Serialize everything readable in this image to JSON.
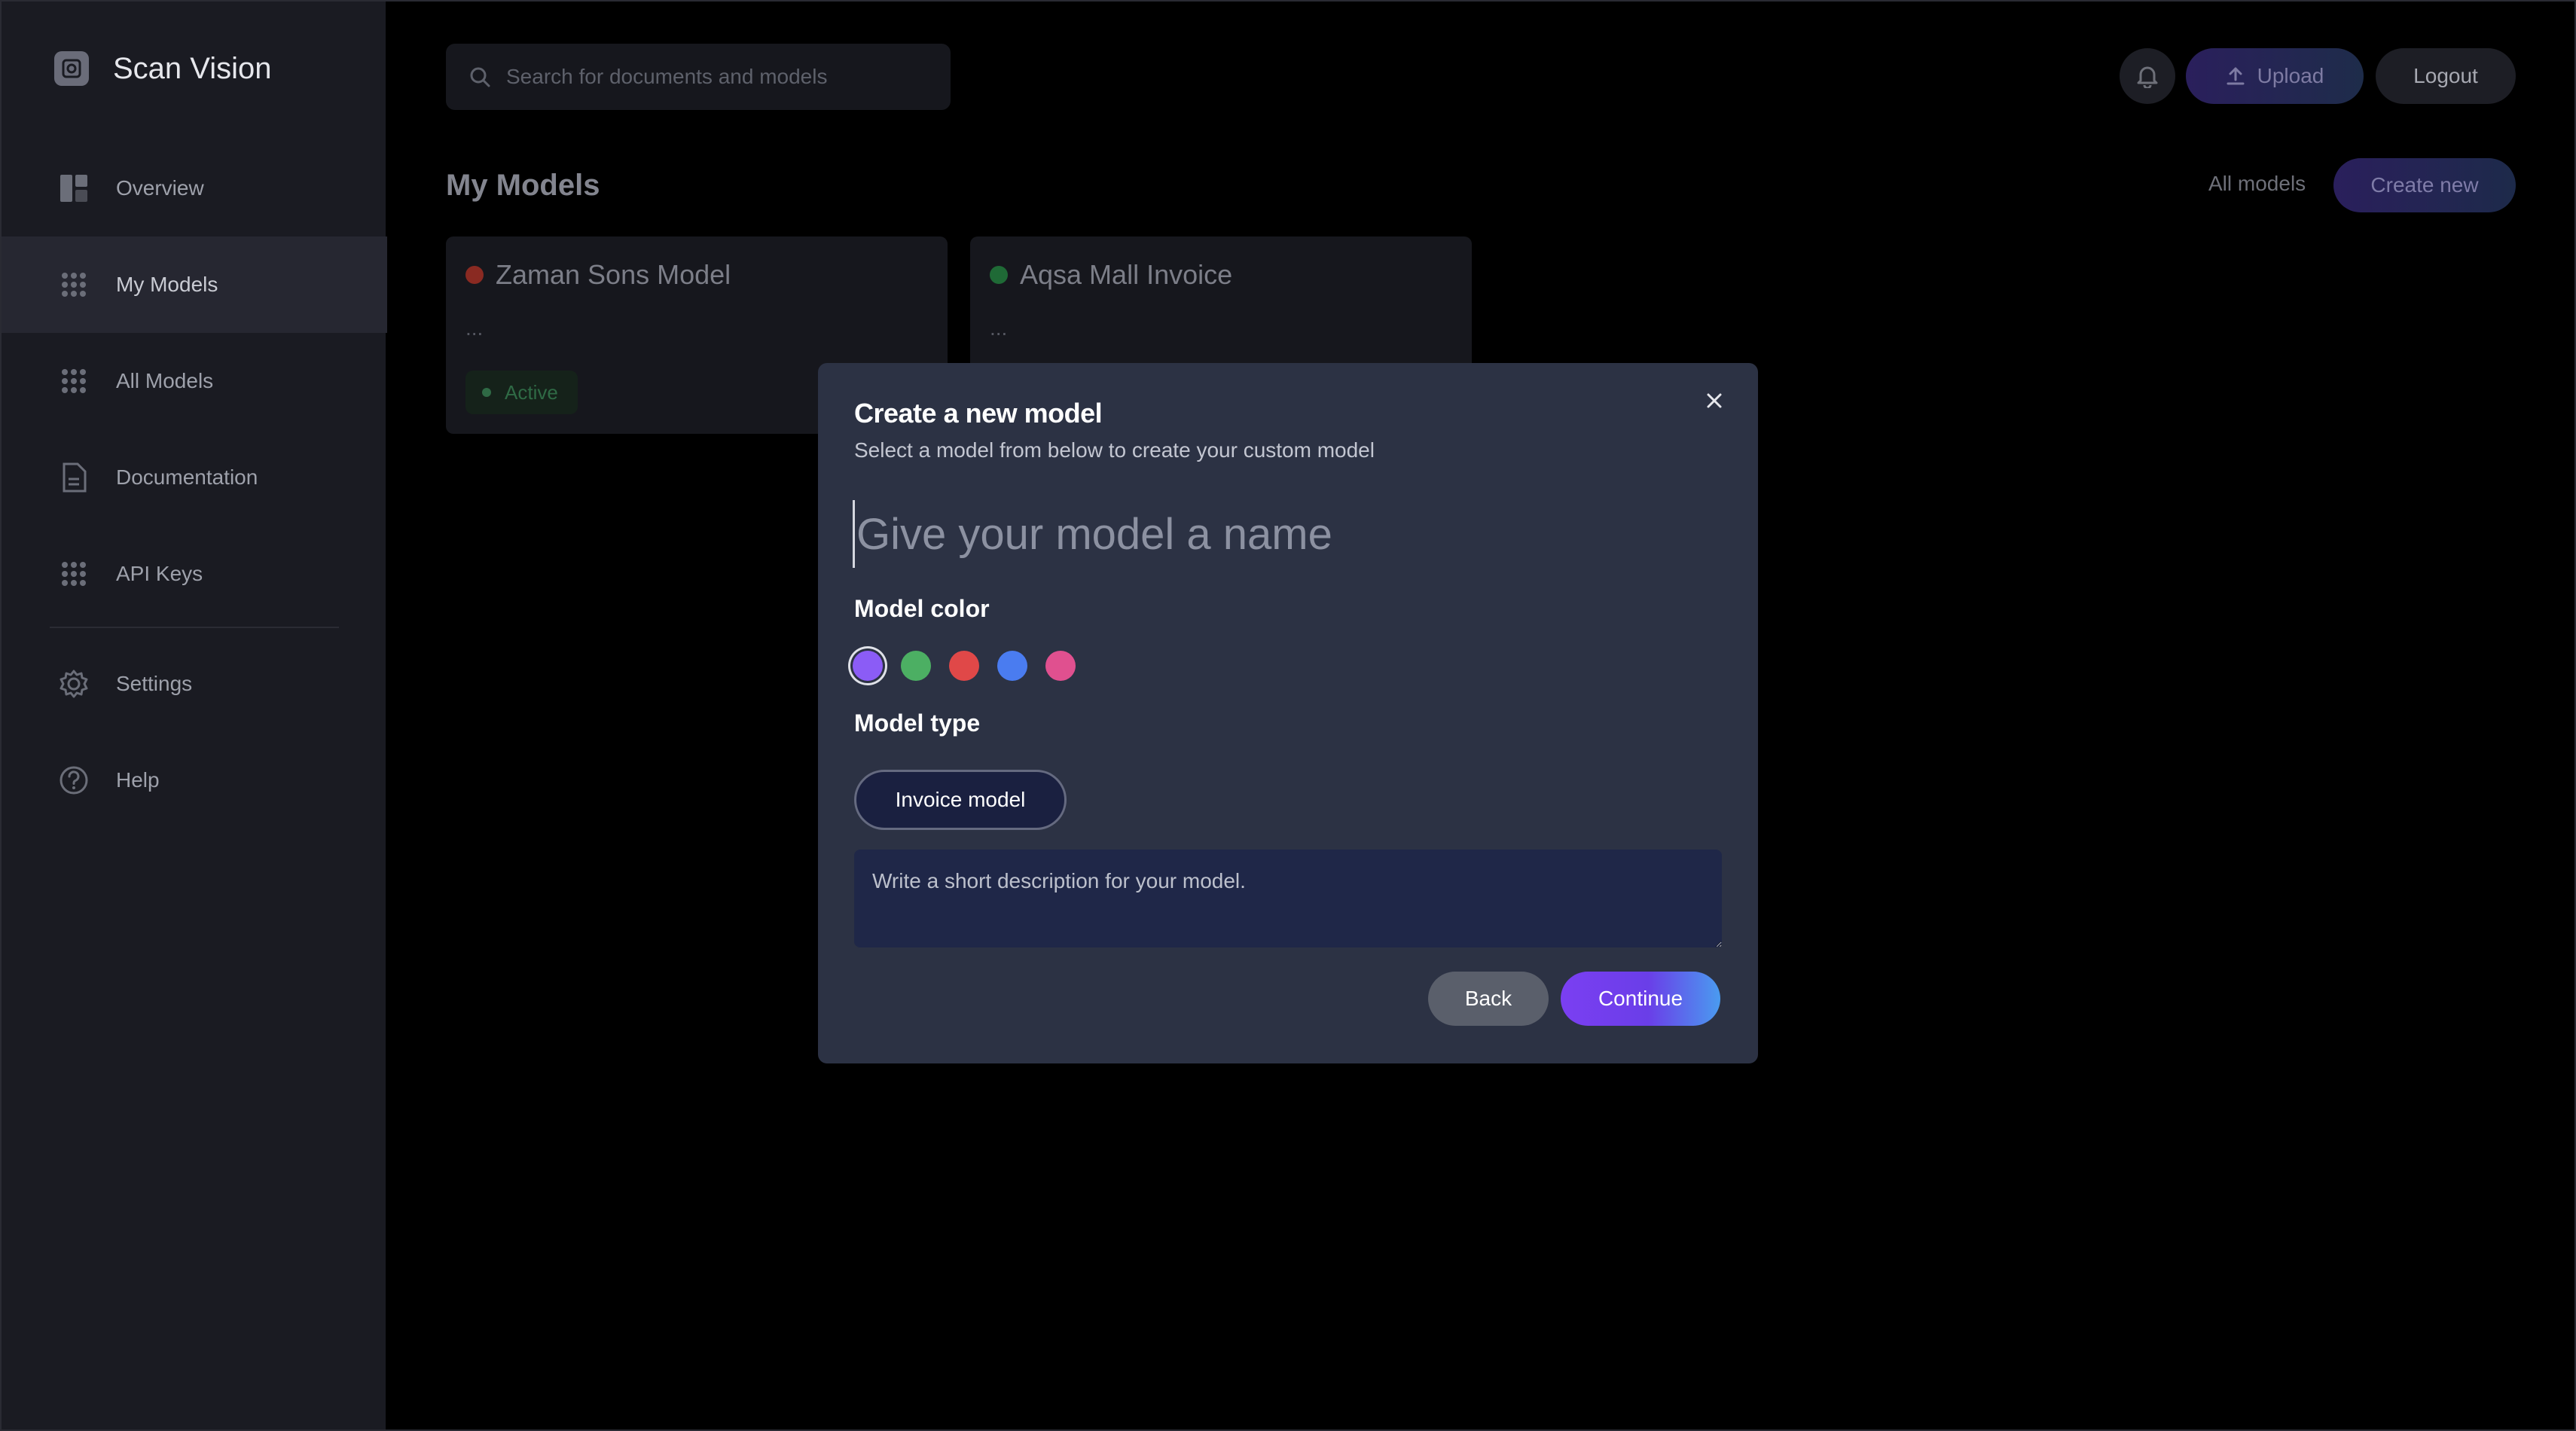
{
  "app": {
    "name": "Scan Vision"
  },
  "sidebar": {
    "items": [
      {
        "label": "Overview",
        "icon": "layout-icon"
      },
      {
        "label": "My Models",
        "icon": "grid-icon",
        "active": true
      },
      {
        "label": "All Models",
        "icon": "grid-icon"
      },
      {
        "label": "Documentation",
        "icon": "document-icon"
      },
      {
        "label": "API Keys",
        "icon": "grid-icon"
      },
      {
        "label": "Settings",
        "icon": "gear-icon"
      },
      {
        "label": "Help",
        "icon": "help-icon"
      }
    ]
  },
  "header": {
    "search_placeholder": "Search for documents and models",
    "upload_label": "Upload",
    "logout_label": "Logout"
  },
  "main": {
    "title": "My Models",
    "all_models_label": "All models",
    "create_new_label": "Create new",
    "cards": [
      {
        "title": "Zaman Sons Model",
        "description": "...",
        "status_color": "#c0392b",
        "badge": "Active"
      },
      {
        "title": "Aqsa Mall Invoice",
        "description": "...",
        "status_color": "#2e8b4a"
      }
    ]
  },
  "modal": {
    "title": "Create a new model",
    "subtitle": "Select a model from below to create your custom model",
    "name_placeholder": "Give your model a name",
    "color_label": "Model color",
    "colors": [
      "#8b5cf6",
      "#4caf63",
      "#e04848",
      "#4a7cf0",
      "#e0508f"
    ],
    "selected_color": "#8b5cf6",
    "type_label": "Model type",
    "type_option": "Invoice model",
    "description_placeholder": "Write a short description for your model.",
    "back_label": "Back",
    "continue_label": "Continue"
  },
  "colors": {
    "modal_bg": "#2c3244",
    "accent_start": "#7b3ff2",
    "accent_end": "#4a9bf0"
  }
}
